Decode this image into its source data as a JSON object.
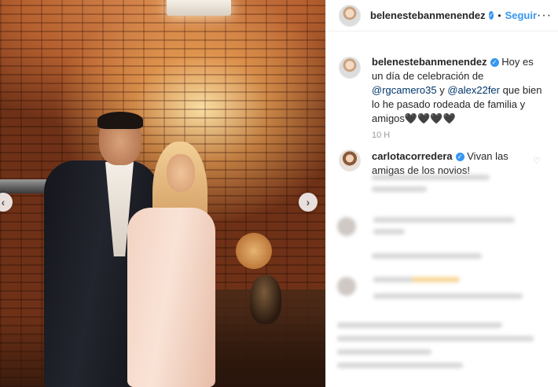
{
  "post": {
    "author": {
      "username": "belenestebanmenendez",
      "verified": true,
      "follow_label": "Seguir",
      "separator": "•"
    },
    "more_options_icon": "more-horizontal-icon",
    "caption": {
      "username": "belenestebanmenendez",
      "text_before": "Hoy es un día de celebración de ",
      "mention_1": "@rgcamero35",
      "text_middle": " y ",
      "mention_2": "@alex22fer",
      "text_after": " que bien lo he pasado rodeada de familia y amigos🖤🖤🖤🖤"
    },
    "time_ago": "10 h",
    "comments": [
      {
        "username": "carlotacorredera",
        "verified": true,
        "text": "Vivan las amigas de los novios!",
        "like_icon": "heart-outline-icon"
      }
    ]
  },
  "photo": {
    "prev_icon": "chevron-left-icon",
    "next_icon": "chevron-right-icon"
  },
  "colors": {
    "accent": "#3897f0",
    "mention": "#003569",
    "text": "#262626",
    "muted": "#999999"
  }
}
